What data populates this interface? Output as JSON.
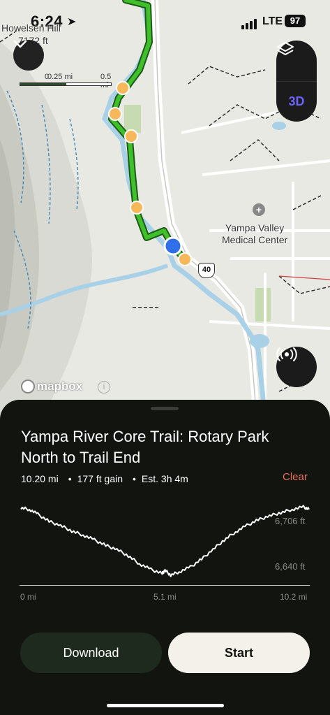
{
  "status_bar": {
    "time": "6:24",
    "network": "LTE",
    "battery": "97"
  },
  "map": {
    "peak_name": "Howelsen Hill",
    "peak_elevation": "7172 ft",
    "scale_labels": [
      "0",
      "0.25 mi",
      "0.5 mi"
    ],
    "poi_name_line1": "Yampa Valley",
    "poi_name_line2": "Medical Center",
    "road_shield": "40",
    "attribution": "mapbox",
    "view_mode_label": "3D",
    "route_color": "#3fbf2a",
    "waypoint_color": "#f6b85a",
    "location_color": "#2f6fe8",
    "river_color": "#a8d0e6",
    "icons": [
      "chevron-down-icon",
      "layers-icon",
      "locate-icon",
      "info-icon",
      "plus-icon"
    ]
  },
  "sheet": {
    "title": "Yampa River Core Trail: Rotary Park North to Trail End",
    "distance": "10.20 mi",
    "gain": "177 ft gain",
    "estimate": "Est. 3h 4m",
    "separator": "•",
    "clear_label": "Clear",
    "download_label": "Download",
    "start_label": "Start",
    "accent_clear": "#e8705a"
  },
  "chart_data": {
    "type": "line",
    "title": "",
    "xlabel": "",
    "ylabel": "",
    "x_tick_labels": [
      "0 mi",
      "5.1 mi",
      "10.2 mi"
    ],
    "y_tick_labels": [
      "6,706 ft",
      "6,640 ft"
    ],
    "xlim": [
      0,
      10.2
    ],
    "ylim": [
      6620,
      6716
    ],
    "grid": false,
    "series": [
      {
        "x": [
          0,
          0.3,
          0.6,
          1.0,
          1.4,
          1.8,
          2.2,
          2.6,
          3.0,
          3.4,
          3.8,
          4.2,
          4.6,
          5.0,
          5.1,
          5.3,
          5.6,
          6.0,
          6.4,
          6.8,
          7.2,
          7.6,
          8.0,
          8.4,
          8.8,
          9.2,
          9.6,
          10.0,
          10.2
        ],
        "y": [
          6712,
          6710,
          6704,
          6695,
          6690,
          6683,
          6678,
          6672,
          6665,
          6660,
          6652,
          6642,
          6635,
          6630,
          6634,
          6628,
          6632,
          6638,
          6648,
          6660,
          6672,
          6682,
          6690,
          6697,
          6702,
          6706,
          6710,
          6713,
          6710
        ]
      }
    ]
  }
}
